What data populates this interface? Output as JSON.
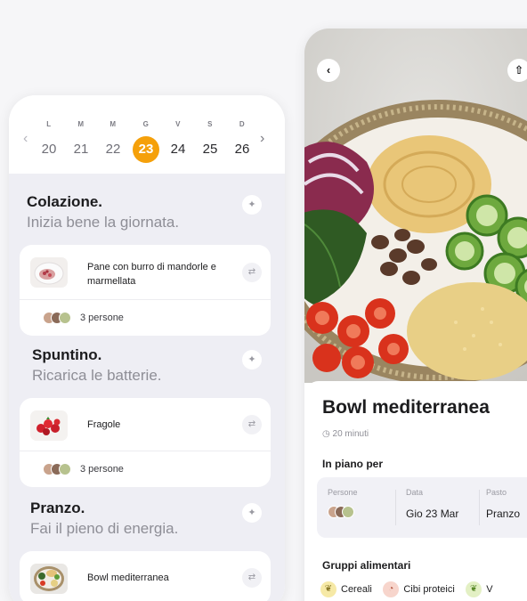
{
  "week": {
    "days": [
      {
        "letter": "L",
        "number": "20"
      },
      {
        "letter": "M",
        "number": "21"
      },
      {
        "letter": "M",
        "number": "22"
      },
      {
        "letter": "G",
        "number": "23"
      },
      {
        "letter": "V",
        "number": "24"
      },
      {
        "letter": "S",
        "number": "25"
      },
      {
        "letter": "D",
        "number": "26"
      }
    ],
    "prev_arrow": "‹",
    "next_arrow": "›"
  },
  "meals": [
    {
      "title": "Colazione.",
      "subtitle": "Inizia bene la giornata.",
      "dish": "Pane con burro di mandorle e marmellata",
      "people": "3 persone"
    },
    {
      "title": "Spuntino.",
      "subtitle": "Ricarica le batterie.",
      "dish": "Fragole",
      "people": "3 persone"
    },
    {
      "title": "Pranzo.",
      "subtitle": "Fai il pieno di energia.",
      "dish": "Bowl mediterranea"
    }
  ],
  "recipe": {
    "back_icon": "‹",
    "share_icon": "⇧",
    "title": "Bowl mediterranea",
    "time_icon": "◷",
    "time": "20 minuti",
    "plan_section": "In piano per",
    "plan": {
      "persons_label": "Persone",
      "date_label": "Data",
      "date_value": "Gio 23 Mar",
      "meal_label": "Pasto",
      "meal_value": "Pranzo"
    },
    "groups_section": "Gruppi alimentari",
    "groups": [
      {
        "icon": "❦",
        "label": "Cereali",
        "color": "#f6e9a6"
      },
      {
        "icon": "◔",
        "label": "Cibi proteici",
        "color": "#f7d5cc"
      },
      {
        "icon": "❦",
        "label": "V",
        "color": "#e3f0c4"
      }
    ]
  },
  "colors": {
    "accent": "#f5a00a"
  }
}
